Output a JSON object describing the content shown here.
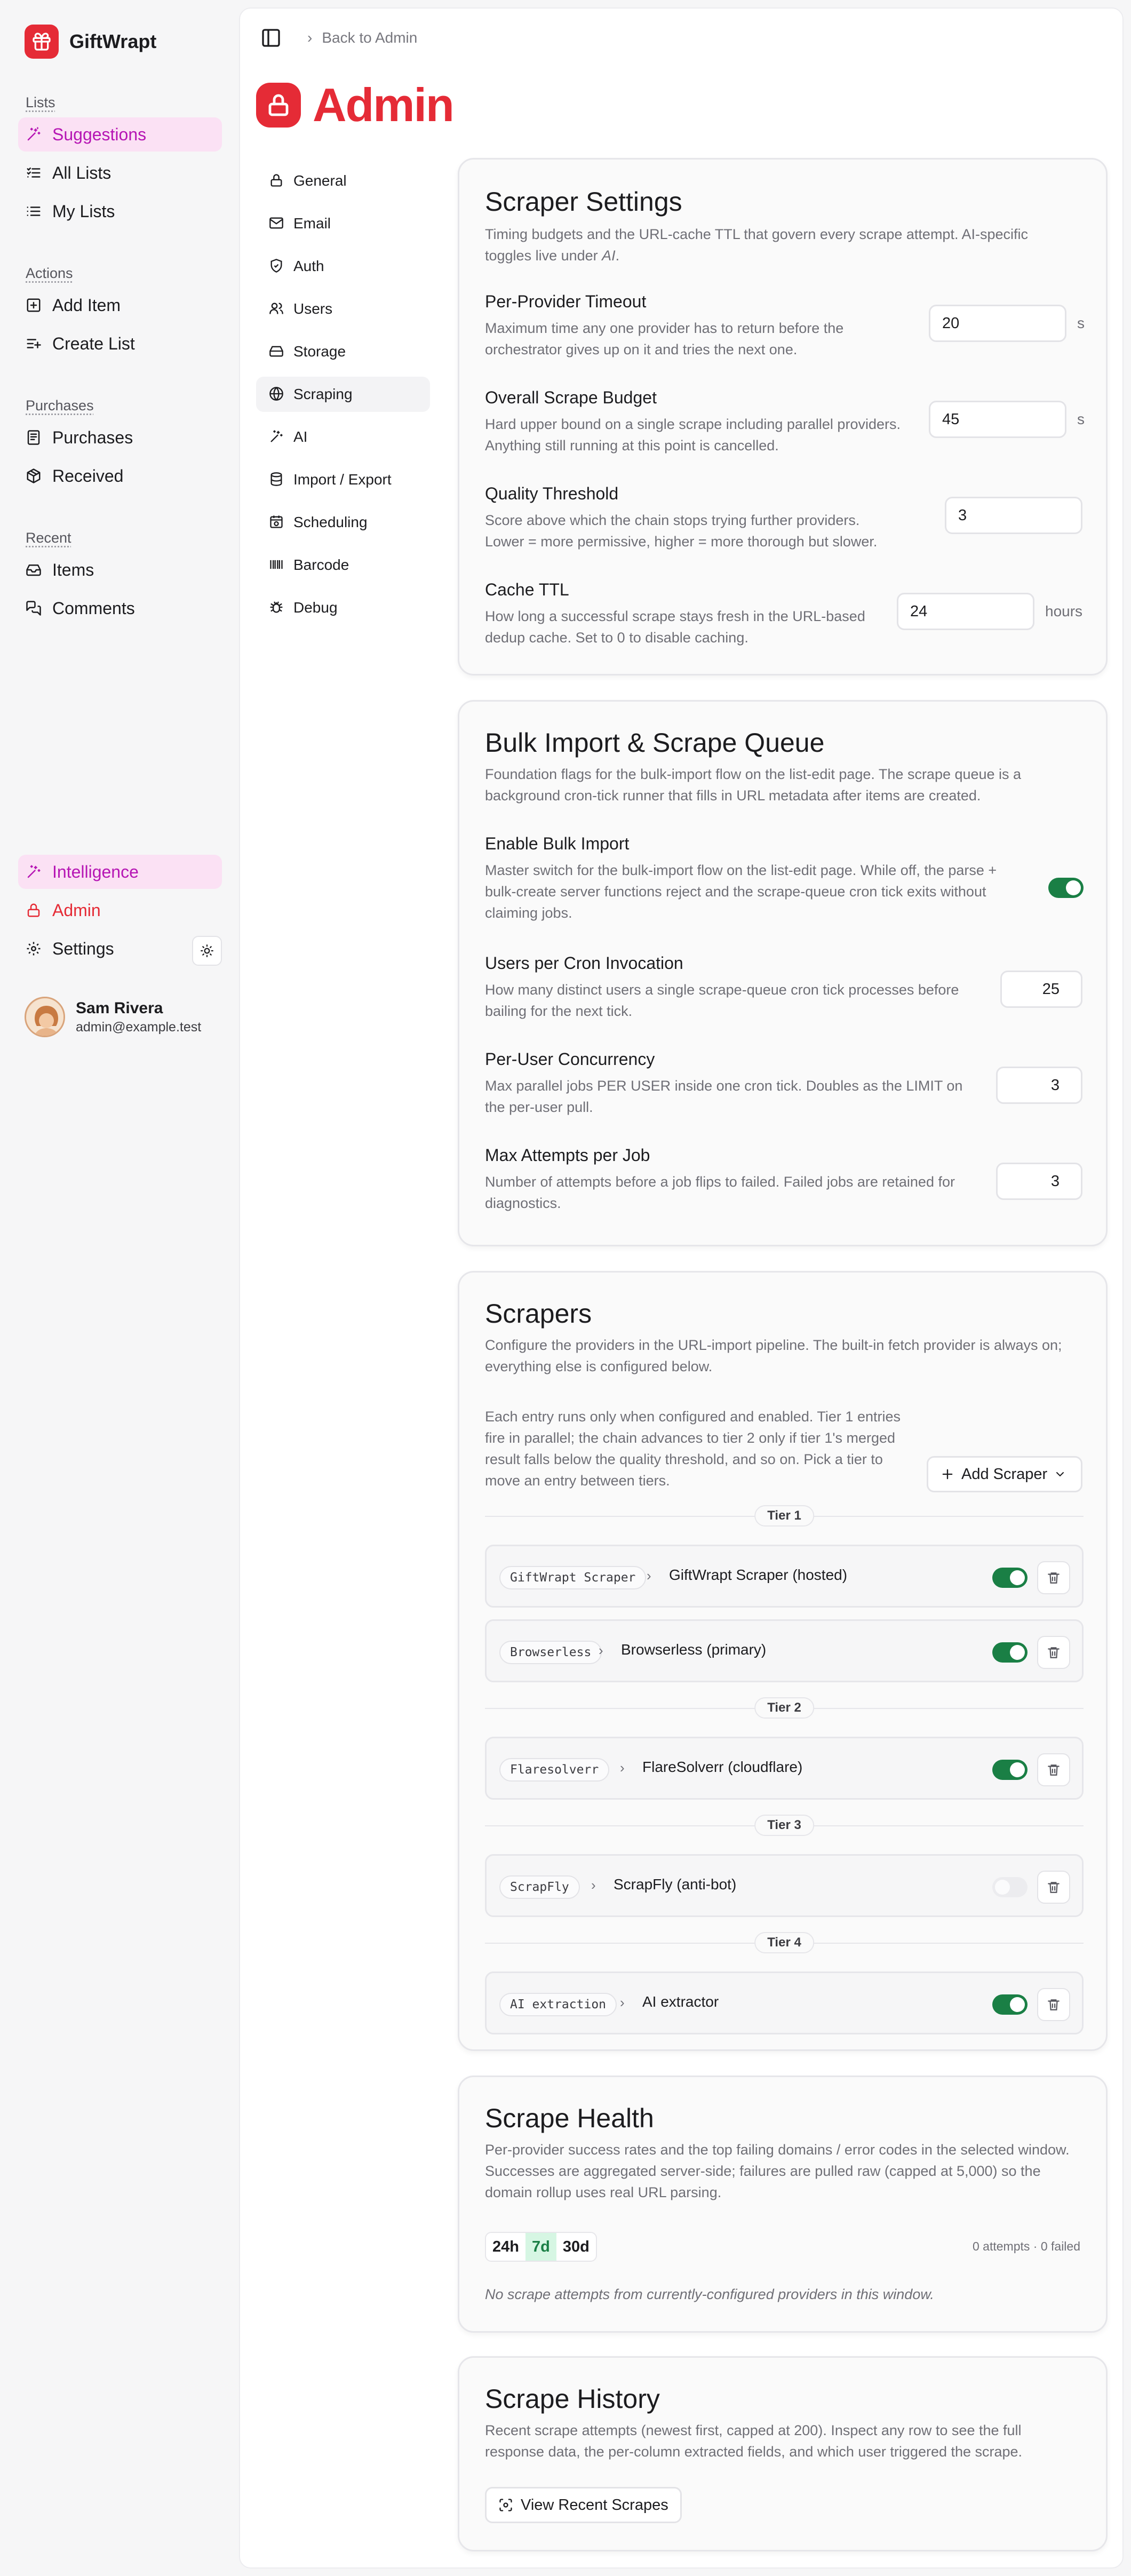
{
  "app": {
    "name": "GiftWrapt",
    "brand_color": "#e52b36",
    "accent_color": "#b616b4"
  },
  "sidebar": {
    "sections": [
      {
        "heading": "Lists",
        "items": [
          {
            "label": "Suggestions",
            "icon": "sparkles-icon",
            "active": true
          },
          {
            "label": "All Lists",
            "icon": "list-check-icon"
          },
          {
            "label": "My Lists",
            "icon": "list-icon"
          }
        ]
      },
      {
        "heading": "Actions",
        "items": [
          {
            "label": "Add Item",
            "icon": "plus-square-icon"
          },
          {
            "label": "Create List",
            "icon": "list-plus-icon"
          }
        ]
      },
      {
        "heading": "Purchases",
        "items": [
          {
            "label": "Purchases",
            "icon": "receipt-icon"
          },
          {
            "label": "Received",
            "icon": "package-icon"
          }
        ]
      },
      {
        "heading": "Recent",
        "items": [
          {
            "label": "Items",
            "icon": "inbox-icon"
          },
          {
            "label": "Comments",
            "icon": "comments-icon"
          }
        ]
      }
    ],
    "bottom": {
      "intelligence": "Intelligence",
      "admin": "Admin",
      "settings": "Settings"
    },
    "user": {
      "name": "Sam Rivera",
      "email": "admin@example.test"
    }
  },
  "topbar": {
    "breadcrumb": "Back to Admin"
  },
  "page": {
    "title": "Admin"
  },
  "subnav": [
    {
      "label": "General",
      "icon": "lock-icon"
    },
    {
      "label": "Email",
      "icon": "mail-icon"
    },
    {
      "label": "Auth",
      "icon": "shield-icon"
    },
    {
      "label": "Users",
      "icon": "users-icon"
    },
    {
      "label": "Storage",
      "icon": "hard-drive-icon"
    },
    {
      "label": "Scraping",
      "icon": "globe-icon",
      "active": true
    },
    {
      "label": "AI",
      "icon": "wand-icon"
    },
    {
      "label": "Import / Export",
      "icon": "database-icon"
    },
    {
      "label": "Scheduling",
      "icon": "calendar-clock-icon"
    },
    {
      "label": "Barcode",
      "icon": "barcode-icon"
    },
    {
      "label": "Debug",
      "icon": "bug-icon"
    }
  ],
  "scraper_settings": {
    "title": "Scraper Settings",
    "desc_pre": "Timing budgets and the URL-cache TTL that govern every scrape attempt. AI-specific toggles live under ",
    "desc_em": "AI",
    "desc_post": ".",
    "rows": [
      {
        "title": "Per-Provider Timeout",
        "desc": "Maximum time any one provider has to return before the orchestrator gives up on it and tries the next one.",
        "value": "20",
        "unit": "s"
      },
      {
        "title": "Overall Scrape Budget",
        "desc": "Hard upper bound on a single scrape including parallel providers. Anything still running at this point is cancelled.",
        "value": "45",
        "unit": "s"
      },
      {
        "title": "Quality Threshold",
        "desc": "Score above which the chain stops trying further providers. Lower = more permissive, higher = more thorough but slower.",
        "value": "3",
        "unit": ""
      },
      {
        "title": "Cache TTL",
        "desc": "How long a successful scrape stays fresh in the URL-based dedup cache. Set to 0 to disable caching.",
        "value": "24",
        "unit": "hours"
      }
    ]
  },
  "bulk_import": {
    "title": "Bulk Import & Scrape Queue",
    "desc": "Foundation flags for the bulk-import flow on the list-edit page. The scrape queue is a background cron-tick runner that fills in URL metadata after items are created.",
    "enable": {
      "title": "Enable Bulk Import",
      "desc": "Master switch for the bulk-import flow on the list-edit page. While off, the parse + bulk-create server functions reject and the scrape-queue cron tick exits without claiming jobs.",
      "on": true
    },
    "rows": [
      {
        "title": "Users per Cron Invocation",
        "desc": "How many distinct users a single scrape-queue cron tick processes before bailing for the next tick.",
        "value": "25"
      },
      {
        "title": "Per-User Concurrency",
        "desc": "Max parallel jobs PER USER inside one cron tick. Doubles as the LIMIT on the per-user pull.",
        "value": "3"
      },
      {
        "title": "Max Attempts per Job",
        "desc": "Number of attempts before a job flips to failed. Failed jobs are retained for diagnostics.",
        "value": "3"
      }
    ]
  },
  "scrapers": {
    "title": "Scrapers",
    "desc": "Configure the providers in the URL-import pipeline. The built-in fetch provider is always on; everything else is configured below.",
    "help": "Each entry runs only when configured and enabled. Tier 1 entries fire in parallel; the chain advances to tier 2 only if tier 1's merged result falls below the quality threshold, and so on. Pick a tier to move an entry between tiers.",
    "add_label": "Add Scraper",
    "tiers": [
      {
        "label": "Tier 1",
        "providers": [
          {
            "code": "GiftWrapt Scraper",
            "name": "GiftWrapt Scraper (hosted)",
            "enabled": true
          },
          {
            "code": "Browserless",
            "name": "Browserless (primary)",
            "enabled": true
          }
        ]
      },
      {
        "label": "Tier 2",
        "providers": [
          {
            "code": "Flaresolverr",
            "name": "FlareSolverr (cloudflare)",
            "enabled": true
          }
        ]
      },
      {
        "label": "Tier 3",
        "providers": [
          {
            "code": "ScrapFly",
            "name": "ScrapFly (anti-bot)",
            "enabled": false
          }
        ]
      },
      {
        "label": "Tier 4",
        "providers": [
          {
            "code": "AI extraction",
            "name": "AI extractor",
            "enabled": true
          }
        ]
      }
    ]
  },
  "health": {
    "title": "Scrape Health",
    "desc": "Per-provider success rates and the top failing domains / error codes in the selected window. Successes are aggregated server-side; failures are pulled raw (capped at 5,000) so the domain rollup uses real URL parsing.",
    "ranges": [
      "24h",
      "7d",
      "30d"
    ],
    "selected_range": "7d",
    "meta": "0 attempts · 0 failed",
    "empty": "No scrape attempts from currently-configured providers in this window."
  },
  "history": {
    "title": "Scrape History",
    "desc": "Recent scrape attempts (newest first, capped at 200). Inspect any row to see the full response data, the per-column extracted fields, and which user triggered the scrape.",
    "button": "View Recent Scrapes"
  }
}
